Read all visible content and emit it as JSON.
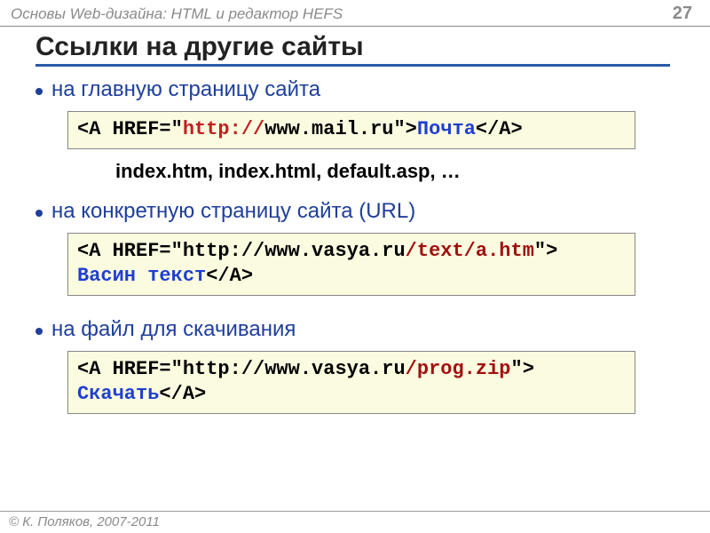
{
  "header": {
    "course_title": "Основы Web-дизайна: HTML и редактор HEFS",
    "page_number": "27"
  },
  "title": "Ссылки на другие сайты",
  "bullets": {
    "b1": "на главную страницу сайта",
    "b2": "на конкретную страницу сайта (URL)",
    "b3": "на файл для скачивания"
  },
  "code1": {
    "p1": "<A HREF=\"",
    "p2": "http://",
    "p3": "www.mail.ru\">",
    "p4": "Почта",
    "p5": "</A>"
  },
  "note1": "index.htm, index.html, default.asp, …",
  "code2": {
    "p1": "<A HREF=\"http://www.vasya.ru",
    "p2": "/text/a.htm",
    "p3": "\">",
    "p4": "Васин текст",
    "p5": "</A>"
  },
  "code3": {
    "p1": "<A HREF=\"http://www.vasya.ru",
    "p2": "/prog.zip",
    "p3": "\">",
    "p4": "Скачать",
    "p5": "</A>"
  },
  "footer": "© К. Поляков, 2007-2011"
}
